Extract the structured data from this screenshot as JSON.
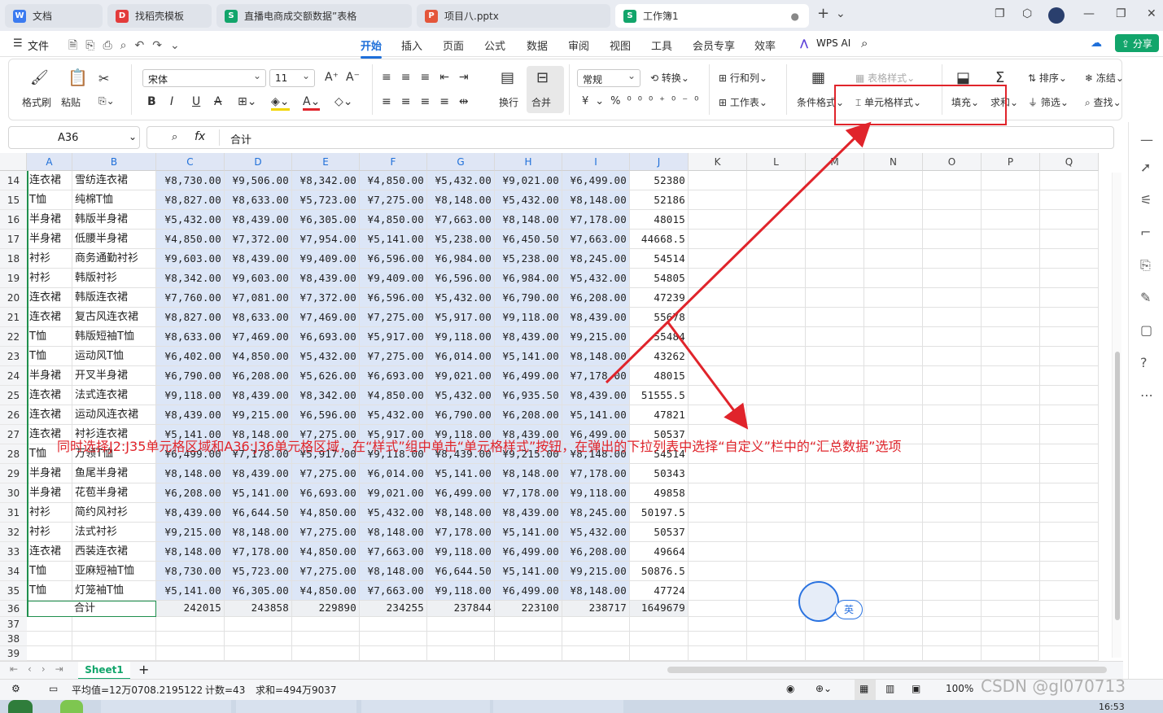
{
  "tabs": [
    {
      "label": "文档",
      "icon_color": "#3b7bf0",
      "icon": "doc-icon"
    },
    {
      "label": "找稻壳模板",
      "icon_color": "#e33b3b",
      "icon": "docer-icon"
    },
    {
      "label": "直播电商成交额数据”表格",
      "icon_color": "#12a56b",
      "icon": "sheet-icon"
    },
    {
      "label": "项目八.pptx",
      "icon_color": "#e4563a",
      "icon": "ppt-icon"
    },
    {
      "label": "工作簿1",
      "icon_color": "#12a56b",
      "icon": "sheet-icon",
      "active": true
    }
  ],
  "menu": {
    "file": "文件",
    "tabs": [
      "开始",
      "插入",
      "页面",
      "公式",
      "数据",
      "审阅",
      "视图",
      "工具",
      "会员专享",
      "效率"
    ],
    "active": "开始",
    "wps_ai": "WPS AI",
    "share": "分享"
  },
  "ribbon": {
    "format_painter": "格式刷",
    "paste": "粘贴",
    "font_name": "宋体",
    "font_size": "11",
    "wrap": "换行",
    "merge": "合并",
    "number_format": "常规",
    "convert": "转换",
    "rows_cols": "行和列",
    "worksheet": "工作表",
    "table_style": "表格样式",
    "cond_format": "条件格式",
    "cell_style": "单元格样式",
    "fill": "填充",
    "sum": "求和",
    "sort": "排序",
    "filter": "筛选",
    "freeze": "冻结",
    "find": "查找"
  },
  "formula_bar": {
    "name_box": "A36",
    "fx": "fx",
    "value": "合计"
  },
  "columns": [
    "A",
    "B",
    "C",
    "D",
    "E",
    "F",
    "G",
    "H",
    "I",
    "J",
    "K",
    "L",
    "M",
    "N",
    "O",
    "P",
    "Q"
  ],
  "rows": [
    {
      "n": "14",
      "a": "连衣裙",
      "b": "雪纺连衣裙",
      "v": [
        "¥8,730.00",
        "¥9,506.00",
        "¥8,342.00",
        "¥4,850.00",
        "¥5,432.00",
        "¥9,021.00",
        "¥6,499.00"
      ],
      "j": "52380"
    },
    {
      "n": "15",
      "a": "T恤",
      "b": "纯棉T恤",
      "v": [
        "¥8,827.00",
        "¥8,633.00",
        "¥5,723.00",
        "¥7,275.00",
        "¥8,148.00",
        "¥5,432.00",
        "¥8,148.00"
      ],
      "j": "52186"
    },
    {
      "n": "16",
      "a": "半身裙",
      "b": "韩版半身裙",
      "v": [
        "¥5,432.00",
        "¥8,439.00",
        "¥6,305.00",
        "¥4,850.00",
        "¥7,663.00",
        "¥8,148.00",
        "¥7,178.00"
      ],
      "j": "48015"
    },
    {
      "n": "17",
      "a": "半身裙",
      "b": "低腰半身裙",
      "v": [
        "¥4,850.00",
        "¥7,372.00",
        "¥7,954.00",
        "¥5,141.00",
        "¥5,238.00",
        "¥6,450.50",
        "¥7,663.00"
      ],
      "j": "44668.5"
    },
    {
      "n": "18",
      "a": "衬衫",
      "b": "商务通勤衬衫",
      "v": [
        "¥9,603.00",
        "¥8,439.00",
        "¥9,409.00",
        "¥6,596.00",
        "¥6,984.00",
        "¥5,238.00",
        "¥8,245.00"
      ],
      "j": "54514"
    },
    {
      "n": "19",
      "a": "衬衫",
      "b": "韩版衬衫",
      "v": [
        "¥8,342.00",
        "¥9,603.00",
        "¥8,439.00",
        "¥9,409.00",
        "¥6,596.00",
        "¥6,984.00",
        "¥5,432.00"
      ],
      "j": "54805"
    },
    {
      "n": "20",
      "a": "连衣裙",
      "b": "韩版连衣裙",
      "v": [
        "¥7,760.00",
        "¥7,081.00",
        "¥7,372.00",
        "¥6,596.00",
        "¥5,432.00",
        "¥6,790.00",
        "¥6,208.00"
      ],
      "j": "47239"
    },
    {
      "n": "21",
      "a": "连衣裙",
      "b": "复古风连衣裙",
      "v": [
        "¥8,827.00",
        "¥8,633.00",
        "¥7,469.00",
        "¥7,275.00",
        "¥5,917.00",
        "¥9,118.00",
        "¥8,439.00"
      ],
      "j": "55678"
    },
    {
      "n": "22",
      "a": "T恤",
      "b": "韩版短袖T恤",
      "v": [
        "¥8,633.00",
        "¥7,469.00",
        "¥6,693.00",
        "¥5,917.00",
        "¥9,118.00",
        "¥8,439.00",
        "¥9,215.00"
      ],
      "j": "55484"
    },
    {
      "n": "23",
      "a": "T恤",
      "b": "运动风T恤",
      "v": [
        "¥6,402.00",
        "¥4,850.00",
        "¥5,432.00",
        "¥7,275.00",
        "¥6,014.00",
        "¥5,141.00",
        "¥8,148.00"
      ],
      "j": "43262"
    },
    {
      "n": "24",
      "a": "半身裙",
      "b": "开叉半身裙",
      "v": [
        "¥6,790.00",
        "¥6,208.00",
        "¥5,626.00",
        "¥6,693.00",
        "¥9,021.00",
        "¥6,499.00",
        "¥7,178.00"
      ],
      "j": "48015"
    },
    {
      "n": "25",
      "a": "连衣裙",
      "b": "法式连衣裙",
      "v": [
        "¥9,118.00",
        "¥8,439.00",
        "¥8,342.00",
        "¥4,850.00",
        "¥5,432.00",
        "¥6,935.50",
        "¥8,439.00"
      ],
      "j": "51555.5"
    },
    {
      "n": "26",
      "a": "连衣裙",
      "b": "运动风连衣裙",
      "v": [
        "¥8,439.00",
        "¥9,215.00",
        "¥6,596.00",
        "¥5,432.00",
        "¥6,790.00",
        "¥6,208.00",
        "¥5,141.00"
      ],
      "j": "47821"
    },
    {
      "n": "27",
      "a": "连衣裙",
      "b": "衬衫连衣裙",
      "v": [
        "¥5,141.00",
        "¥8,148.00",
        "¥7,275.00",
        "¥5,917.00",
        "¥9,118.00",
        "¥8,439.00",
        "¥6,499.00"
      ],
      "j": "50537"
    },
    {
      "n": "28",
      "a": "T恤",
      "b": "万领T恤",
      "v": [
        "¥6,499.00",
        "¥7,178.00",
        "¥5,917.00",
        "¥9,118.00",
        "¥8,439.00",
        "¥9,215.00",
        "¥8,148.00"
      ],
      "j": "54514"
    },
    {
      "n": "29",
      "a": "半身裙",
      "b": "鱼尾半身裙",
      "v": [
        "¥8,148.00",
        "¥8,439.00",
        "¥7,275.00",
        "¥6,014.00",
        "¥5,141.00",
        "¥8,148.00",
        "¥7,178.00"
      ],
      "j": "50343"
    },
    {
      "n": "30",
      "a": "半身裙",
      "b": "花苞半身裙",
      "v": [
        "¥6,208.00",
        "¥5,141.00",
        "¥6,693.00",
        "¥9,021.00",
        "¥6,499.00",
        "¥7,178.00",
        "¥9,118.00"
      ],
      "j": "49858"
    },
    {
      "n": "31",
      "a": "衬衫",
      "b": "简约风衬衫",
      "v": [
        "¥8,439.00",
        "¥6,644.50",
        "¥4,850.00",
        "¥5,432.00",
        "¥8,148.00",
        "¥8,439.00",
        "¥8,245.00"
      ],
      "j": "50197.5"
    },
    {
      "n": "32",
      "a": "衬衫",
      "b": "法式衬衫",
      "v": [
        "¥9,215.00",
        "¥8,148.00",
        "¥7,275.00",
        "¥8,148.00",
        "¥7,178.00",
        "¥5,141.00",
        "¥5,432.00"
      ],
      "j": "50537"
    },
    {
      "n": "33",
      "a": "连衣裙",
      "b": "西装连衣裙",
      "v": [
        "¥8,148.00",
        "¥7,178.00",
        "¥4,850.00",
        "¥7,663.00",
        "¥9,118.00",
        "¥6,499.00",
        "¥6,208.00"
      ],
      "j": "49664"
    },
    {
      "n": "34",
      "a": "T恤",
      "b": "亚麻短袖T恤",
      "v": [
        "¥8,730.00",
        "¥5,723.00",
        "¥7,275.00",
        "¥8,148.00",
        "¥6,644.50",
        "¥5,141.00",
        "¥9,215.00"
      ],
      "j": "50876.5"
    },
    {
      "n": "35",
      "a": "T恤",
      "b": "灯笼袖T恤",
      "v": [
        "¥5,141.00",
        "¥6,305.00",
        "¥4,850.00",
        "¥7,663.00",
        "¥9,118.00",
        "¥6,499.00",
        "¥8,148.00"
      ],
      "j": "47724"
    }
  ],
  "total_row": {
    "n": "36",
    "label": "合计",
    "v": [
      "242015",
      "243858",
      "229890",
      "234255",
      "237844",
      "223100",
      "238717"
    ],
    "j": "1649679"
  },
  "empty_rows": [
    "37",
    "38",
    "39"
  ],
  "annotation": "同时选择J2:J35单元格区域和A36:J36单元格区域，在“样式”组中单击“单元格样式”按钮，在弹出的下拉列表中选择“自定义”栏中的“汇总数据”选项",
  "sheet_tab": "Sheet1",
  "status": {
    "avg": "平均值=12万0708.2195122",
    "count": "计数=43",
    "sum": "求和=494万9037",
    "zoom": "100%"
  },
  "ime_label": "英",
  "watermark": "CSDN @gl070713",
  "clock": "16:53",
  "colors": {
    "accent": "#1e6fd9",
    "selection": "#dce6f7",
    "annotation": "#e0242b",
    "highlight_box": "#e0242b"
  }
}
